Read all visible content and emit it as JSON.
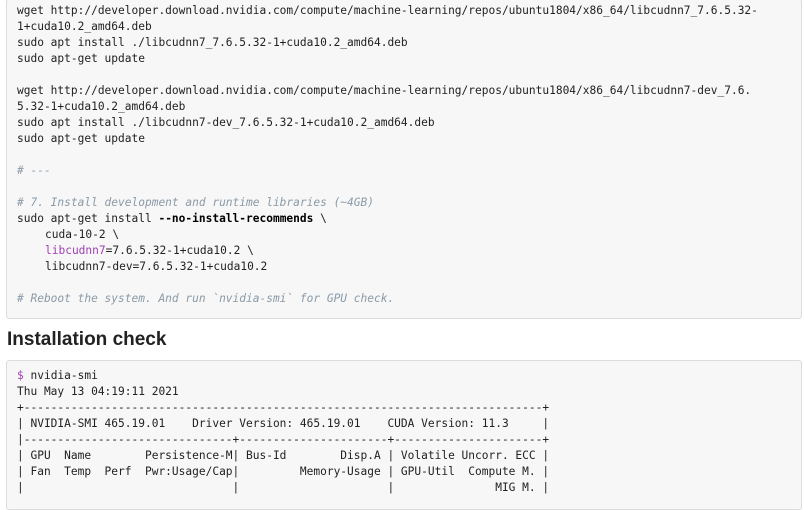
{
  "install_block": {
    "lines": [
      "wget http://developer.download.nvidia.com/compute/machine-learning/repos/ubuntu1804/x86_64/libcudnn7_7.6.5.32-",
      "1+cuda10.2_amd64.deb",
      "sudo apt install ./libcudnn7_7.6.5.32-1+cuda10.2_amd64.deb",
      "sudo apt-get update",
      "wget http://developer.download.nvidia.com/compute/machine-learning/repos/ubuntu1804/x86_64/libcudnn7-dev_7.6.",
      "5.32-1+cuda10.2_amd64.deb",
      "sudo apt install ./libcudnn7-dev_7.6.5.32-1+cuda10.2_amd64.deb",
      "sudo apt-get update",
      "# ---",
      "# 7. Install development and runtime libraries (~4GB)",
      "--no-install-recommends",
      "cuda-10-2 \\",
      "libcudnn7",
      "=7.6.5.32-1+cuda10.2 \\",
      "libcudnn7-dev=7.6.5.32-1+cuda10.2",
      "# Reboot the system. And run `nvidia-smi` for GPU check."
    ],
    "install_prefix": "sudo apt-get install ",
    "install_suffix": " \\"
  },
  "section_heading": "Installation check",
  "check_block": {
    "prompt": "$",
    "command": " nvidia-smi",
    "lines": [
      "Thu May 13 04:19:11 2021",
      "+-----------------------------------------------------------------------------+",
      "| NVIDIA-SMI 465.19.01    Driver Version: 465.19.01    CUDA Version: 11.3     |",
      "|-------------------------------+----------------------+----------------------+",
      "| GPU  Name        Persistence-M| Bus-Id        Disp.A | Volatile Uncorr. ECC |",
      "| Fan  Temp  Perf  Pwr:Usage/Cap|         Memory-Usage | GPU-Util  Compute M. |",
      "|                               |                      |               MIG M. |"
    ]
  }
}
